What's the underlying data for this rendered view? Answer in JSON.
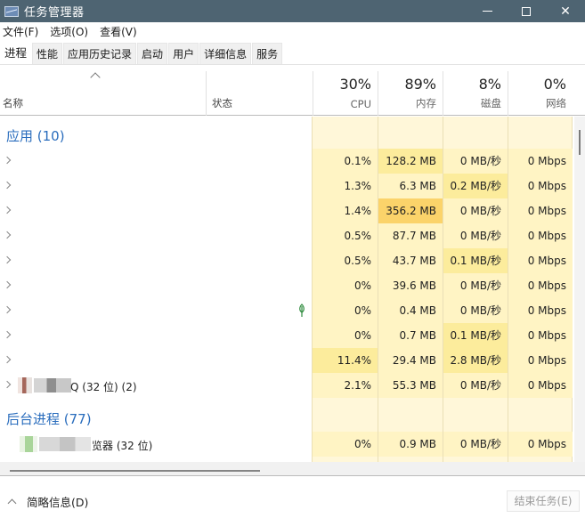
{
  "window": {
    "title": "任务管理器",
    "icon": "task-manager-icon",
    "controls": {
      "minimize": "minimize-icon",
      "maximize": "maximize-icon",
      "close": "✕"
    }
  },
  "menu": [
    "文件(F)",
    "选项(O)",
    "查看(V)"
  ],
  "tabs": [
    {
      "label": "进程",
      "active": true
    },
    {
      "label": "性能",
      "active": false
    },
    {
      "label": "应用历史记录",
      "active": false
    },
    {
      "label": "启动",
      "active": false
    },
    {
      "label": "用户",
      "active": false
    },
    {
      "label": "详细信息",
      "active": false
    },
    {
      "label": "服务",
      "active": false
    }
  ],
  "columns": {
    "name": "名称",
    "status": "状态",
    "metrics": [
      {
        "pct": "30%",
        "label": "CPU"
      },
      {
        "pct": "89%",
        "label": "内存"
      },
      {
        "pct": "8%",
        "label": "磁盘"
      },
      {
        "pct": "0%",
        "label": "网络"
      }
    ]
  },
  "groups": {
    "apps": "应用 (10)",
    "background": "后台进程 (77)"
  },
  "app_rows": [
    {
      "name": "",
      "cpu": "0.1%",
      "mem": "128.2 MB",
      "disk": "0 MB/秒",
      "net": "0 Mbps"
    },
    {
      "name": "",
      "cpu": "1.3%",
      "mem": "6.3 MB",
      "disk": "0.2 MB/秒",
      "net": "0 Mbps"
    },
    {
      "name": "",
      "cpu": "1.4%",
      "mem": "356.2 MB",
      "disk": "0 MB/秒",
      "net": "0 Mbps"
    },
    {
      "name": "",
      "cpu": "0.5%",
      "mem": "87.7 MB",
      "disk": "0 MB/秒",
      "net": "0 Mbps"
    },
    {
      "name": "",
      "cpu": "0.5%",
      "mem": "43.7 MB",
      "disk": "0.1 MB/秒",
      "net": "0 Mbps"
    },
    {
      "name": "",
      "cpu": "0%",
      "mem": "39.6 MB",
      "disk": "0 MB/秒",
      "net": "0 Mbps"
    },
    {
      "name": "",
      "cpu": "0%",
      "mem": "0.4 MB",
      "disk": "0 MB/秒",
      "net": "0 Mbps",
      "status_icon": "efficiency-leaf-icon"
    },
    {
      "name": "",
      "cpu": "0%",
      "mem": "0.7 MB",
      "disk": "0.1 MB/秒",
      "net": "0 Mbps"
    },
    {
      "name": "",
      "cpu": "11.4%",
      "mem": "29.4 MB",
      "disk": "2.8 MB/秒",
      "net": "0 Mbps"
    },
    {
      "name": "Q (32 位) (2)",
      "cpu": "2.1%",
      "mem": "55.3 MB",
      "disk": "0 MB/秒",
      "net": "0 Mbps"
    }
  ],
  "bg_rows": [
    {
      "name": "览器 (32 位)",
      "cpu": "0%",
      "mem": "0.9 MB",
      "disk": "0 MB/秒",
      "net": "0 Mbps"
    }
  ],
  "footer": {
    "details_toggle": "简略信息(D)",
    "end_task": "结束任务(E)"
  },
  "colors": {
    "titlebar": "#4e6472",
    "group_label": "#2a6dbd",
    "heat_low": "#fff4c4",
    "heat_mid": "#fcec9c",
    "heat_high": "#fbd36a"
  }
}
